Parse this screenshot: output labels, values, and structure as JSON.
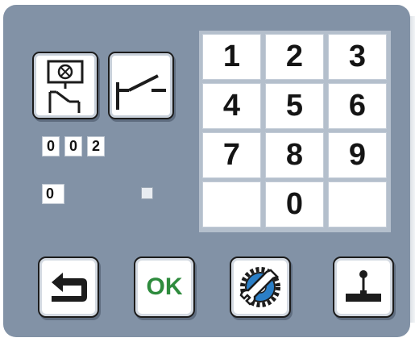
{
  "keypad": {
    "keys": [
      "1",
      "2",
      "3",
      "4",
      "5",
      "6",
      "7",
      "8",
      "9",
      "",
      "0",
      ""
    ]
  },
  "counter": {
    "digits": [
      "0",
      "0",
      "2"
    ]
  },
  "value": {
    "digit": "0"
  },
  "buttons": {
    "ok_label": "OK"
  },
  "icons": {
    "contact_schematic": "relay-contact-schematic-icon",
    "switch": "switch-contact-icon",
    "back": "return-arrow-icon",
    "settings": "wrench-gear-icon",
    "output": "joystick-lever-icon"
  },
  "colors": {
    "panel": "#8292a6",
    "keypad_frame": "#b4bfcc",
    "ok_text": "#2e8b3d",
    "gear_blue": "#2b7fc7"
  }
}
